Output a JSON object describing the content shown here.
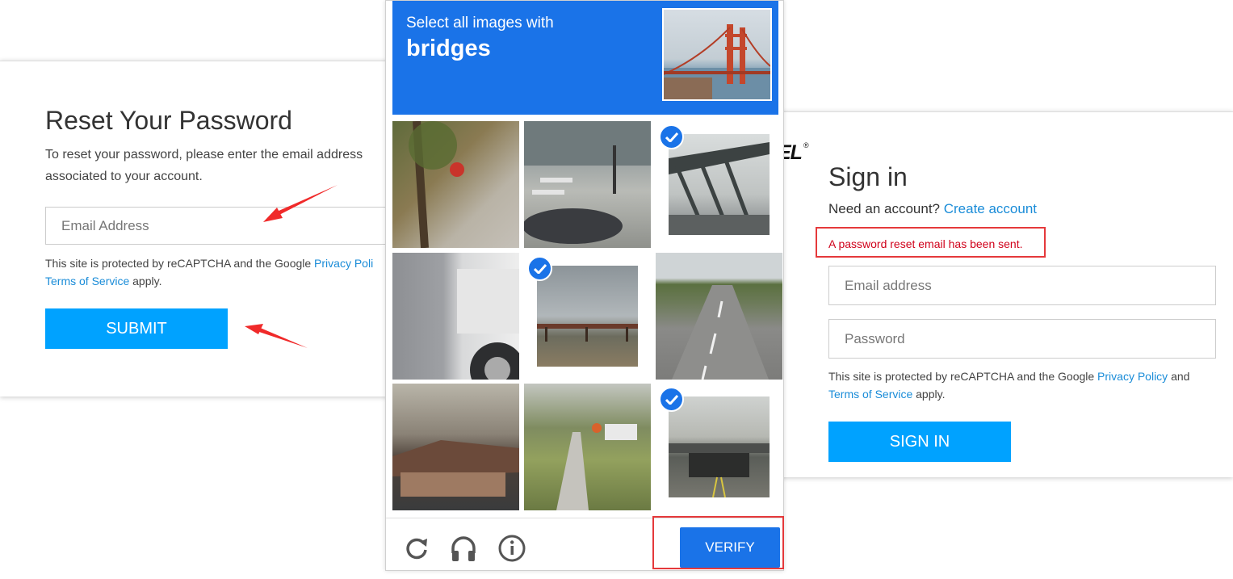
{
  "reset_form": {
    "title": "Reset Your Password",
    "description": "To reset your password, please enter the email address associated to your account.",
    "email_placeholder": "Email Address",
    "legal_prefix": "This site is protected by reCAPTCHA and the Google ",
    "privacy_link": "Privacy Poli",
    "terms_link": "Terms of Service",
    "legal_suffix": " apply.",
    "submit_label": "SUBMIT"
  },
  "captcha": {
    "instruction": "Select all images with",
    "target": "bridges",
    "tiles": [
      {
        "scene": "tree-closeup",
        "selected": false
      },
      {
        "scene": "street-crosswalk-car",
        "selected": false
      },
      {
        "scene": "steel-truss-bridge",
        "selected": true
      },
      {
        "scene": "truck-fender",
        "selected": false
      },
      {
        "scene": "pier-over-water",
        "selected": true
      },
      {
        "scene": "highway-road",
        "selected": false
      },
      {
        "scene": "roadside-building",
        "selected": false
      },
      {
        "scene": "suburban-sidewalk",
        "selected": false
      },
      {
        "scene": "road-overpass",
        "selected": true
      }
    ],
    "icons": [
      "reload-icon",
      "audio-icon",
      "info-icon"
    ],
    "verify_label": "VERIFY"
  },
  "signin_form": {
    "logo_fragment": "EL",
    "logo_registered": "®",
    "title": "Sign in",
    "need_account": "Need an account? ",
    "create_account_link": "Create account",
    "reset_sent_message": "A password reset email has been sent.",
    "email_placeholder": "Email address",
    "password_placeholder": "Password",
    "legal_prefix": "This site is protected by reCAPTCHA and the Google ",
    "privacy_link": "Privacy Policy",
    "legal_middle": " and ",
    "terms_link": "Terms of Service",
    "legal_suffix": " apply.",
    "signin_label": "SIGN IN"
  },
  "colors": {
    "accent_button": "#00a2ff",
    "captcha_blue": "#1a73e8",
    "highlight_red": "#e5393b",
    "error_text": "#d0021b",
    "link": "#1a8cd8"
  }
}
